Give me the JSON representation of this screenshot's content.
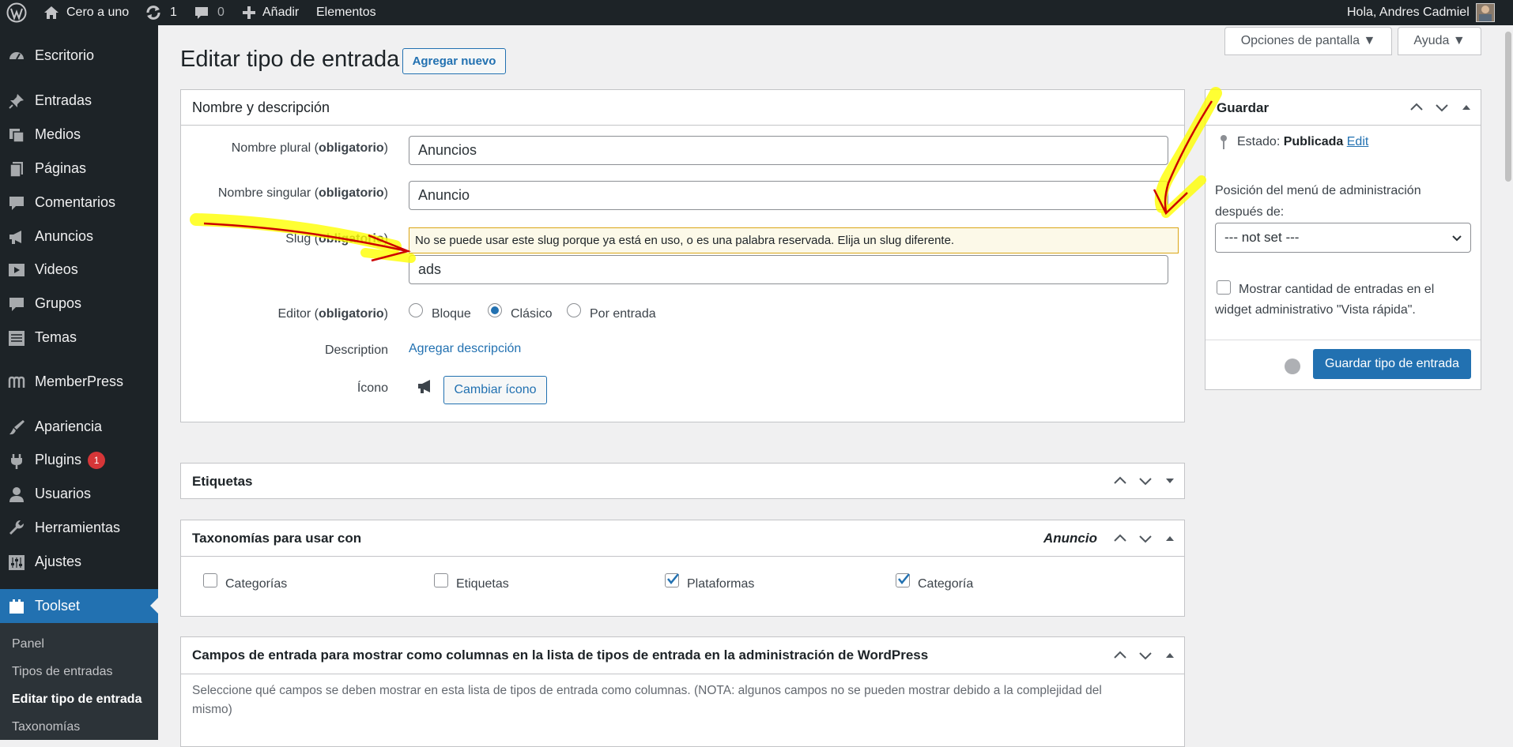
{
  "adminbar": {
    "wp_logo": "wordpress-icon",
    "site_name": "Cero a uno",
    "updates_count": "1",
    "comments_count": "0",
    "add_new": "Añadir",
    "elements": "Elementos",
    "greeting": "Hola, Andres Cadmiel"
  },
  "sidebar": {
    "items": [
      {
        "label": "Escritorio",
        "icon": "dashboard-icon"
      },
      {
        "label": "Entradas",
        "icon": "pin-icon"
      },
      {
        "label": "Medios",
        "icon": "media-icon"
      },
      {
        "label": "Páginas",
        "icon": "pages-icon"
      },
      {
        "label": "Comentarios",
        "icon": "comment-icon"
      },
      {
        "label": "Anuncios",
        "icon": "megaphone-icon"
      },
      {
        "label": "Videos",
        "icon": "video-icon"
      },
      {
        "label": "Grupos",
        "icon": "groups-icon"
      },
      {
        "label": "Temas",
        "icon": "list-icon"
      },
      {
        "label": "MemberPress",
        "icon": "memberpress-icon"
      },
      {
        "label": "Apariencia",
        "icon": "brush-icon"
      },
      {
        "label": "Plugins",
        "icon": "plugin-icon",
        "badge": "1"
      },
      {
        "label": "Usuarios",
        "icon": "user-icon"
      },
      {
        "label": "Herramientas",
        "icon": "wrench-icon"
      },
      {
        "label": "Ajustes",
        "icon": "settings-icon"
      },
      {
        "label": "Toolset",
        "icon": "toolset-icon",
        "current": true
      }
    ],
    "submenu": [
      "Panel",
      "Tipos de entradas",
      "Editar tipo de entrada",
      "Taxonomías"
    ]
  },
  "topbar": {
    "screen_options": "Opciones de pantalla ▼",
    "help": "Ayuda ▼"
  },
  "page": {
    "title": "Editar tipo de entrada",
    "add_new": "Agregar nuevo"
  },
  "name_box": {
    "title": "Nombre y descripción",
    "plural_label": "Nombre plural (",
    "singular_label": "Nombre singular (",
    "slug_label": "Slug (",
    "editor_label": "Editor (",
    "required": "obligatorio",
    "close_paren": ")",
    "plural_value": "Anuncios",
    "singular_value": "Anuncio",
    "slug_value": "ads",
    "slug_error": "No se puede usar este slug porque ya está en uso, o es una palabra reservada. Elija un slug diferente.",
    "editor_options": [
      "Bloque",
      "Clásico",
      "Por entrada"
    ],
    "editor_selected": "Clásico",
    "description_label": "Description",
    "description_link": "Agregar descripción",
    "icon_label": "Ícono",
    "change_icon": "Cambiar ícono"
  },
  "tags_box": {
    "title": "Etiquetas"
  },
  "taxonomies_box": {
    "title": "Taxonomías para usar con",
    "post_type": "Anuncio",
    "items": [
      {
        "label": "Categorías",
        "checked": false
      },
      {
        "label": "Etiquetas",
        "checked": false
      },
      {
        "label": "Plataformas",
        "checked": true
      },
      {
        "label": "Categoría",
        "checked": true
      }
    ]
  },
  "fields_box": {
    "title": "Campos de entrada para mostrar como columnas en la lista de tipos de entrada en la administración de WordPress",
    "desc_line1": "Seleccione qué campos se deben mostrar en esta lista de tipos de entrada como columnas. (NOTA: algunos campos no se pueden mostrar debido a la complejidad del",
    "desc_line2": "mismo)"
  },
  "save_box": {
    "title": "Guardar",
    "status_label": "Estado:",
    "status_value": "Publicada",
    "edit_link": "Edit",
    "menu_position_line1": "Posición del menú de administración",
    "menu_position_line2": "después de:",
    "menu_position_value": "--- not set ---",
    "show_count_line1": "Mostrar cantidad de entradas en el",
    "show_count_line2": "widget administrativo \"Vista rápida\".",
    "save_button": "Guardar tipo de entrada"
  },
  "colors": {
    "accent": "#2271b1",
    "admin_bg": "#1d2327",
    "highlight": "#ffff00",
    "annotation_red": "#cc0000"
  }
}
